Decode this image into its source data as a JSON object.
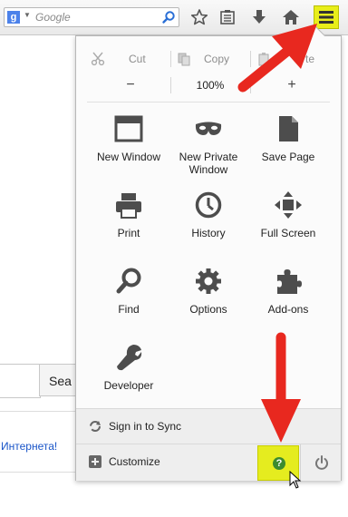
{
  "toolbar": {
    "search_placeholder": "Google",
    "search_engine_letter": "g",
    "icons": [
      "star-icon",
      "reading-list-icon",
      "download-icon",
      "home-icon",
      "hamburger-menu-icon"
    ]
  },
  "page": {
    "search_button_label": "Sea",
    "link_text": "Интернета!"
  },
  "menu": {
    "edit": {
      "cut_label": "Cut",
      "copy_label": "Copy",
      "paste_label": "te"
    },
    "zoom": {
      "minus_label": "−",
      "value": "100%",
      "plus_label": "+"
    },
    "items": [
      {
        "label": "New Window",
        "icon": "new-window-icon"
      },
      {
        "label": "New Private Window",
        "icon": "private-mask-icon"
      },
      {
        "label": "Save Page",
        "icon": "save-page-icon"
      },
      {
        "label": "Print",
        "icon": "printer-icon"
      },
      {
        "label": "History",
        "icon": "clock-icon"
      },
      {
        "label": "Full Screen",
        "icon": "fullscreen-icon"
      },
      {
        "label": "Find",
        "icon": "magnifier-icon"
      },
      {
        "label": "Options",
        "icon": "gear-icon"
      },
      {
        "label": "Add-ons",
        "icon": "puzzle-icon"
      },
      {
        "label": "Developer",
        "icon": "wrench-icon"
      }
    ],
    "sync_label": "Sign in to Sync",
    "customize_label": "Customize",
    "help_symbol": "?"
  },
  "colors": {
    "highlight": "#e5ec1f",
    "arrow": "#e8281f",
    "help_green": "#3c8b2f",
    "link_blue": "#1a55c8"
  }
}
